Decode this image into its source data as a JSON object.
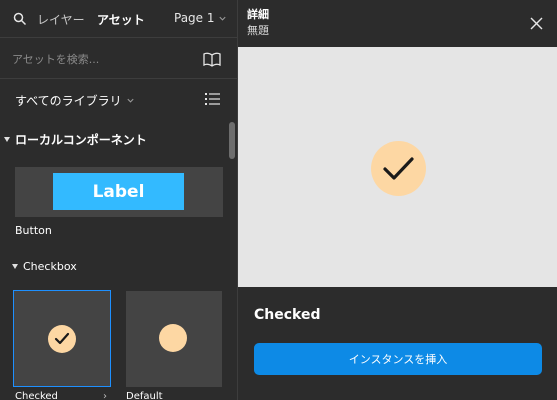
{
  "left_panel": {
    "tabs": {
      "layers": "レイヤー",
      "assets": "アセット"
    },
    "page_selector": "Page 1",
    "search": {
      "placeholder": "アセットを検索..."
    },
    "libraries_label": "すべてのライブラリ",
    "local_components_heading": "ローカルコンポーネント",
    "button_component": {
      "thumbnail_label": "Label",
      "name": "Button"
    },
    "checkbox_group": {
      "heading": "Checkbox",
      "items": [
        {
          "name": "Checked",
          "selected": true
        },
        {
          "name": "Default",
          "selected": false
        }
      ]
    }
  },
  "right_panel": {
    "title": "詳細",
    "subtitle": "無題",
    "component_name": "Checked",
    "insert_button": "インスタンスを挿入"
  },
  "colors": {
    "panel_bg": "#2c2c2c",
    "thumb_bg": "#444444",
    "accent_blue": "#0d8ae6",
    "label_blue": "#33baff",
    "selection_border": "#1e90ff",
    "checkbox_fill": "#fdd7a3",
    "preview_bg": "#e5e5e5"
  },
  "icons": [
    "search-icon",
    "chevron-down-icon",
    "book-icon",
    "list-icon",
    "caret-down-icon",
    "check-icon",
    "close-icon"
  ]
}
